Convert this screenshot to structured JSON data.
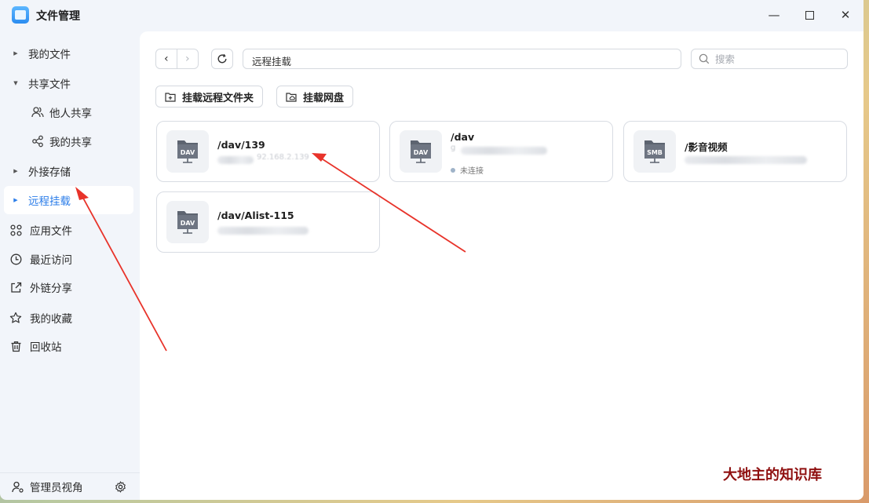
{
  "app": {
    "title": "文件管理"
  },
  "window_controls": {
    "minimize": "—",
    "maximize": "☐",
    "close": "✕"
  },
  "sidebar": {
    "items": [
      {
        "label": "我的文件",
        "icon": "caret-right-icon"
      },
      {
        "label": "共享文件",
        "icon": "caret-down-icon"
      },
      {
        "label": "他人共享",
        "icon": "users-icon"
      },
      {
        "label": "我的共享",
        "icon": "share-nodes-icon"
      },
      {
        "label": "外接存储",
        "icon": "caret-right-icon"
      },
      {
        "label": "远程挂载",
        "icon": "caret-right-icon",
        "active": true
      },
      {
        "label": "应用文件",
        "icon": "apps-grid-icon"
      },
      {
        "label": "最近访问",
        "icon": "clock-icon"
      },
      {
        "label": "外链分享",
        "icon": "external-share-icon"
      },
      {
        "label": "我的收藏",
        "icon": "star-icon"
      },
      {
        "label": "回收站",
        "icon": "trash-icon"
      }
    ],
    "footer": {
      "label": "管理员视角"
    }
  },
  "toolbar": {
    "path": "远程挂载",
    "search_placeholder": "搜索",
    "mount_remote_folder": "挂载远程文件夹",
    "mount_netdisk": "挂载网盘"
  },
  "mounts": [
    {
      "name": "/dav/139",
      "type": "DAV",
      "partial_text": "92.168.2.139"
    },
    {
      "name": "/dav",
      "type": "DAV",
      "partial_text": "g",
      "status": "未连接"
    },
    {
      "name": "/影音视频",
      "type": "SMB"
    },
    {
      "name": "/dav/Alist-115",
      "type": "DAV"
    }
  ],
  "watermark": "大地主的知识库",
  "colors": {
    "accent": "#2b7de9",
    "annotation_arrow": "#e8332a",
    "watermark": "#8f1010"
  }
}
